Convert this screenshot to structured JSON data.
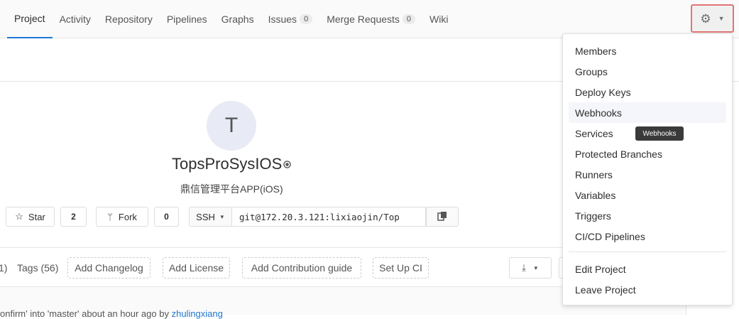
{
  "nav": {
    "tabs": [
      {
        "label": "Project"
      },
      {
        "label": "Activity"
      },
      {
        "label": "Repository"
      },
      {
        "label": "Pipelines"
      },
      {
        "label": "Graphs"
      },
      {
        "label": "Issues",
        "count": "0"
      },
      {
        "label": "Merge Requests",
        "count": "0"
      },
      {
        "label": "Wiki"
      }
    ],
    "settings_icon": "gear-icon",
    "dropdown_icon": "caret-down-icon"
  },
  "project": {
    "avatar_letter": "T",
    "name": "TopsProSysIOS",
    "visibility_icon": "globe-icon",
    "description": "鼎信管理平台APP(iOS)"
  },
  "actions": {
    "star_label": "Star",
    "star_count": "2",
    "fork_label": "Fork",
    "fork_count": "0",
    "protocol": "SSH",
    "clone_url": "git@172.20.3.121:lixiaojin/Top",
    "copy_icon": "clipboard-icon"
  },
  "stats": {
    "branches_fragment": "1)",
    "tags": "Tags (56)"
  },
  "quick_links": [
    {
      "label": "Add Changelog"
    },
    {
      "label": "Add License"
    },
    {
      "label": "Add Contribution guide"
    },
    {
      "label": "Set Up CI"
    }
  ],
  "download_icon": "download-icon",
  "commit_line": {
    "text": "onfirm' into 'master'  about an hour ago by",
    "author": "zhulingxiang"
  },
  "settings_menu": {
    "items": [
      {
        "label": "Members"
      },
      {
        "label": "Groups"
      },
      {
        "label": "Deploy Keys"
      },
      {
        "label": "Webhooks"
      },
      {
        "label": "Services"
      },
      {
        "label": "Protected Branches"
      },
      {
        "label": "Runners"
      },
      {
        "label": "Variables"
      },
      {
        "label": "Triggers"
      },
      {
        "label": "CI/CD Pipelines"
      },
      {
        "label": "Edit Project"
      },
      {
        "label": "Leave Project"
      }
    ],
    "tooltip": "Webhooks"
  }
}
